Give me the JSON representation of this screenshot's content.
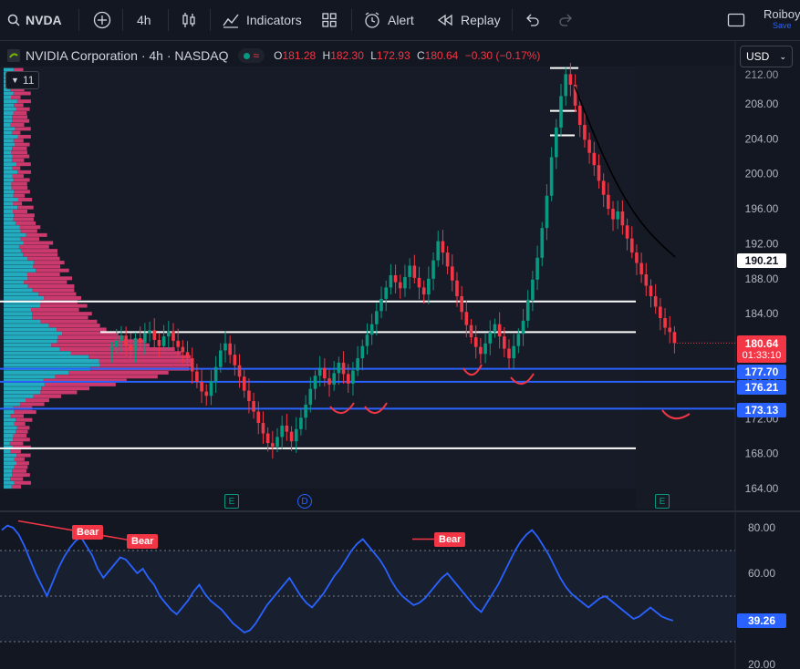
{
  "toolbar": {
    "symbol": "NVDA",
    "interval": "4h",
    "indicators_label": "Indicators",
    "alert_label": "Alert",
    "replay_label": "Replay",
    "user_name": "Roiboy",
    "save_label": "Save"
  },
  "legend": {
    "title": "NVIDIA Corporation · 4h · NASDAQ",
    "o_label": "O",
    "o": "181.28",
    "h_label": "H",
    "h": "182.30",
    "l_label": "L",
    "l": "172.93",
    "c_label": "C",
    "c": "180.64",
    "change": "−0.30 (−0.17%)",
    "indicator_count": "11"
  },
  "currency": "USD",
  "colors": {
    "up": "#089981",
    "down": "#f23645",
    "rsi": "#2962ff",
    "volume_profile_up": "#26c6da",
    "volume_profile_down": "#ec407a",
    "support_line": "#2962ff",
    "level_line": "#ffffff",
    "markup": "#f23645"
  },
  "price_axis": {
    "ticks": [
      "208.00",
      "204.00",
      "200.00",
      "196.00",
      "192.00",
      "188.00",
      "184.00",
      "180.00",
      "176.00",
      "172.00",
      "168.00",
      "164.00"
    ],
    "top_partial": "212.00"
  },
  "price_labels": {
    "last": "180.64",
    "countdown": "01:33:10",
    "ma": "190.21",
    "level1": "177.70",
    "level2": "176.21",
    "level3": "173.13"
  },
  "events": {
    "earnings": "E",
    "dividend": "D"
  },
  "rsi": {
    "ticks": [
      "80.00",
      "60.00",
      "20.00"
    ],
    "value": "39.26",
    "bear_label": "Bear",
    "upper_band": 70,
    "lower_band": 30,
    "mid": 50
  },
  "chart_data": [
    {
      "type": "candlestick",
      "symbol": "NVDA",
      "interval": "4h",
      "ylim": [
        163,
        213
      ],
      "last_close": 180.64,
      "horizontal_levels_white": [
        185.4,
        181.9,
        168.6
      ],
      "horizontal_levels_blue": [
        177.7,
        176.21,
        173.13
      ],
      "top_step_levels": [
        212.1,
        207.2,
        204.4
      ],
      "close_series": [
        180.2,
        180.9,
        181.5,
        180.4,
        179.8,
        181.2,
        180.7,
        181.8,
        182.1,
        181.0,
        180.3,
        181.4,
        182.0,
        180.9,
        180.2,
        179.6,
        178.9,
        177.4,
        176.2,
        175.1,
        174.6,
        176.3,
        177.9,
        179.8,
        180.6,
        179.3,
        178.1,
        176.8,
        175.2,
        174.0,
        172.8,
        171.5,
        170.3,
        169.2,
        168.8,
        169.9,
        171.2,
        170.5,
        169.4,
        170.8,
        172.1,
        173.6,
        175.4,
        176.9,
        177.8,
        176.6,
        175.9,
        177.2,
        178.4,
        177.1,
        176.0,
        177.5,
        178.9,
        180.3,
        181.6,
        182.8,
        184.3,
        185.7,
        187.0,
        188.4,
        187.6,
        186.9,
        188.2,
        189.5,
        188.1,
        187.0,
        186.2,
        188.0,
        190.1,
        192.3,
        191.0,
        189.4,
        187.8,
        186.0,
        184.2,
        182.7,
        181.3,
        180.2,
        179.4,
        180.6,
        181.9,
        182.8,
        181.4,
        180.0,
        178.9,
        180.3,
        181.7,
        183.2,
        185.6,
        187.9,
        190.4,
        193.8,
        197.5,
        201.9,
        205.3,
        208.9,
        211.4,
        210.2,
        207.8,
        205.6,
        203.9,
        202.4,
        201.0,
        199.2,
        197.6,
        196.0,
        194.8,
        195.7,
        194.1,
        192.6,
        191.0,
        189.8,
        188.5,
        187.2,
        186.0,
        184.8,
        183.5,
        182.4,
        181.9,
        180.64
      ]
    },
    {
      "type": "line",
      "title": "RSI",
      "ylim": [
        20,
        85
      ],
      "last": 39.26,
      "values": [
        79,
        81,
        80,
        77,
        72,
        66,
        60,
        55,
        50,
        56,
        62,
        67,
        71,
        74,
        76,
        72,
        68,
        62,
        58,
        61,
        64,
        67,
        66,
        63,
        60,
        62,
        58,
        55,
        50,
        47,
        44,
        42,
        45,
        48,
        52,
        55,
        51,
        48,
        46,
        44,
        41,
        38,
        36,
        34,
        35,
        38,
        42,
        46,
        49,
        52,
        55,
        58,
        54,
        50,
        47,
        45,
        48,
        51,
        55,
        59,
        62,
        66,
        70,
        73,
        75,
        72,
        69,
        66,
        62,
        57,
        53,
        50,
        48,
        46,
        47,
        49,
        52,
        55,
        58,
        60,
        57,
        54,
        51,
        48,
        45,
        43,
        47,
        51,
        55,
        60,
        65,
        70,
        74,
        77,
        79,
        76,
        72,
        68,
        63,
        58,
        54,
        51,
        49,
        47,
        45,
        47,
        49,
        50,
        48,
        46,
        44,
        42,
        40,
        41,
        43,
        45,
        43,
        41,
        40,
        39.26
      ]
    }
  ]
}
